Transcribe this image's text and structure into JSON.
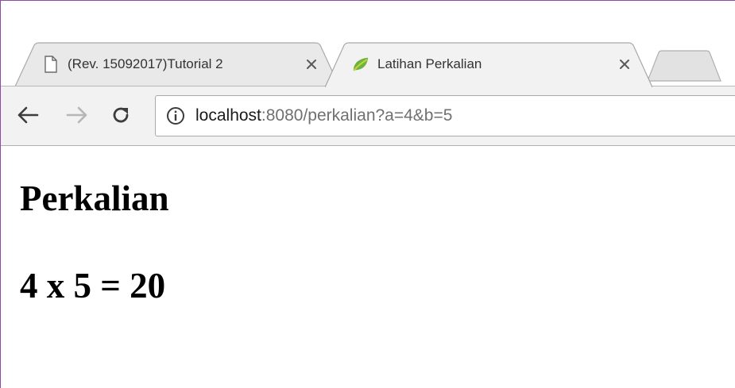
{
  "browser": {
    "tabs": [
      {
        "title": "(Rev. 15092017)Tutorial 2",
        "icon": "document-icon",
        "active": false
      },
      {
        "title": "Latihan Perkalian",
        "icon": "spring-leaf-icon",
        "active": true
      }
    ],
    "address_bar": {
      "host": "localhost",
      "path": ":8080/perkalian?a=4&b=5"
    }
  },
  "page": {
    "heading": "Perkalian",
    "result": "4 x 5 = 20"
  },
  "colors": {
    "window_border": "#8e4aa8",
    "toolbar_bg": "#f2f2f2",
    "leaf_green": "#6db33f",
    "leaf_yellow": "#c8d43a"
  }
}
